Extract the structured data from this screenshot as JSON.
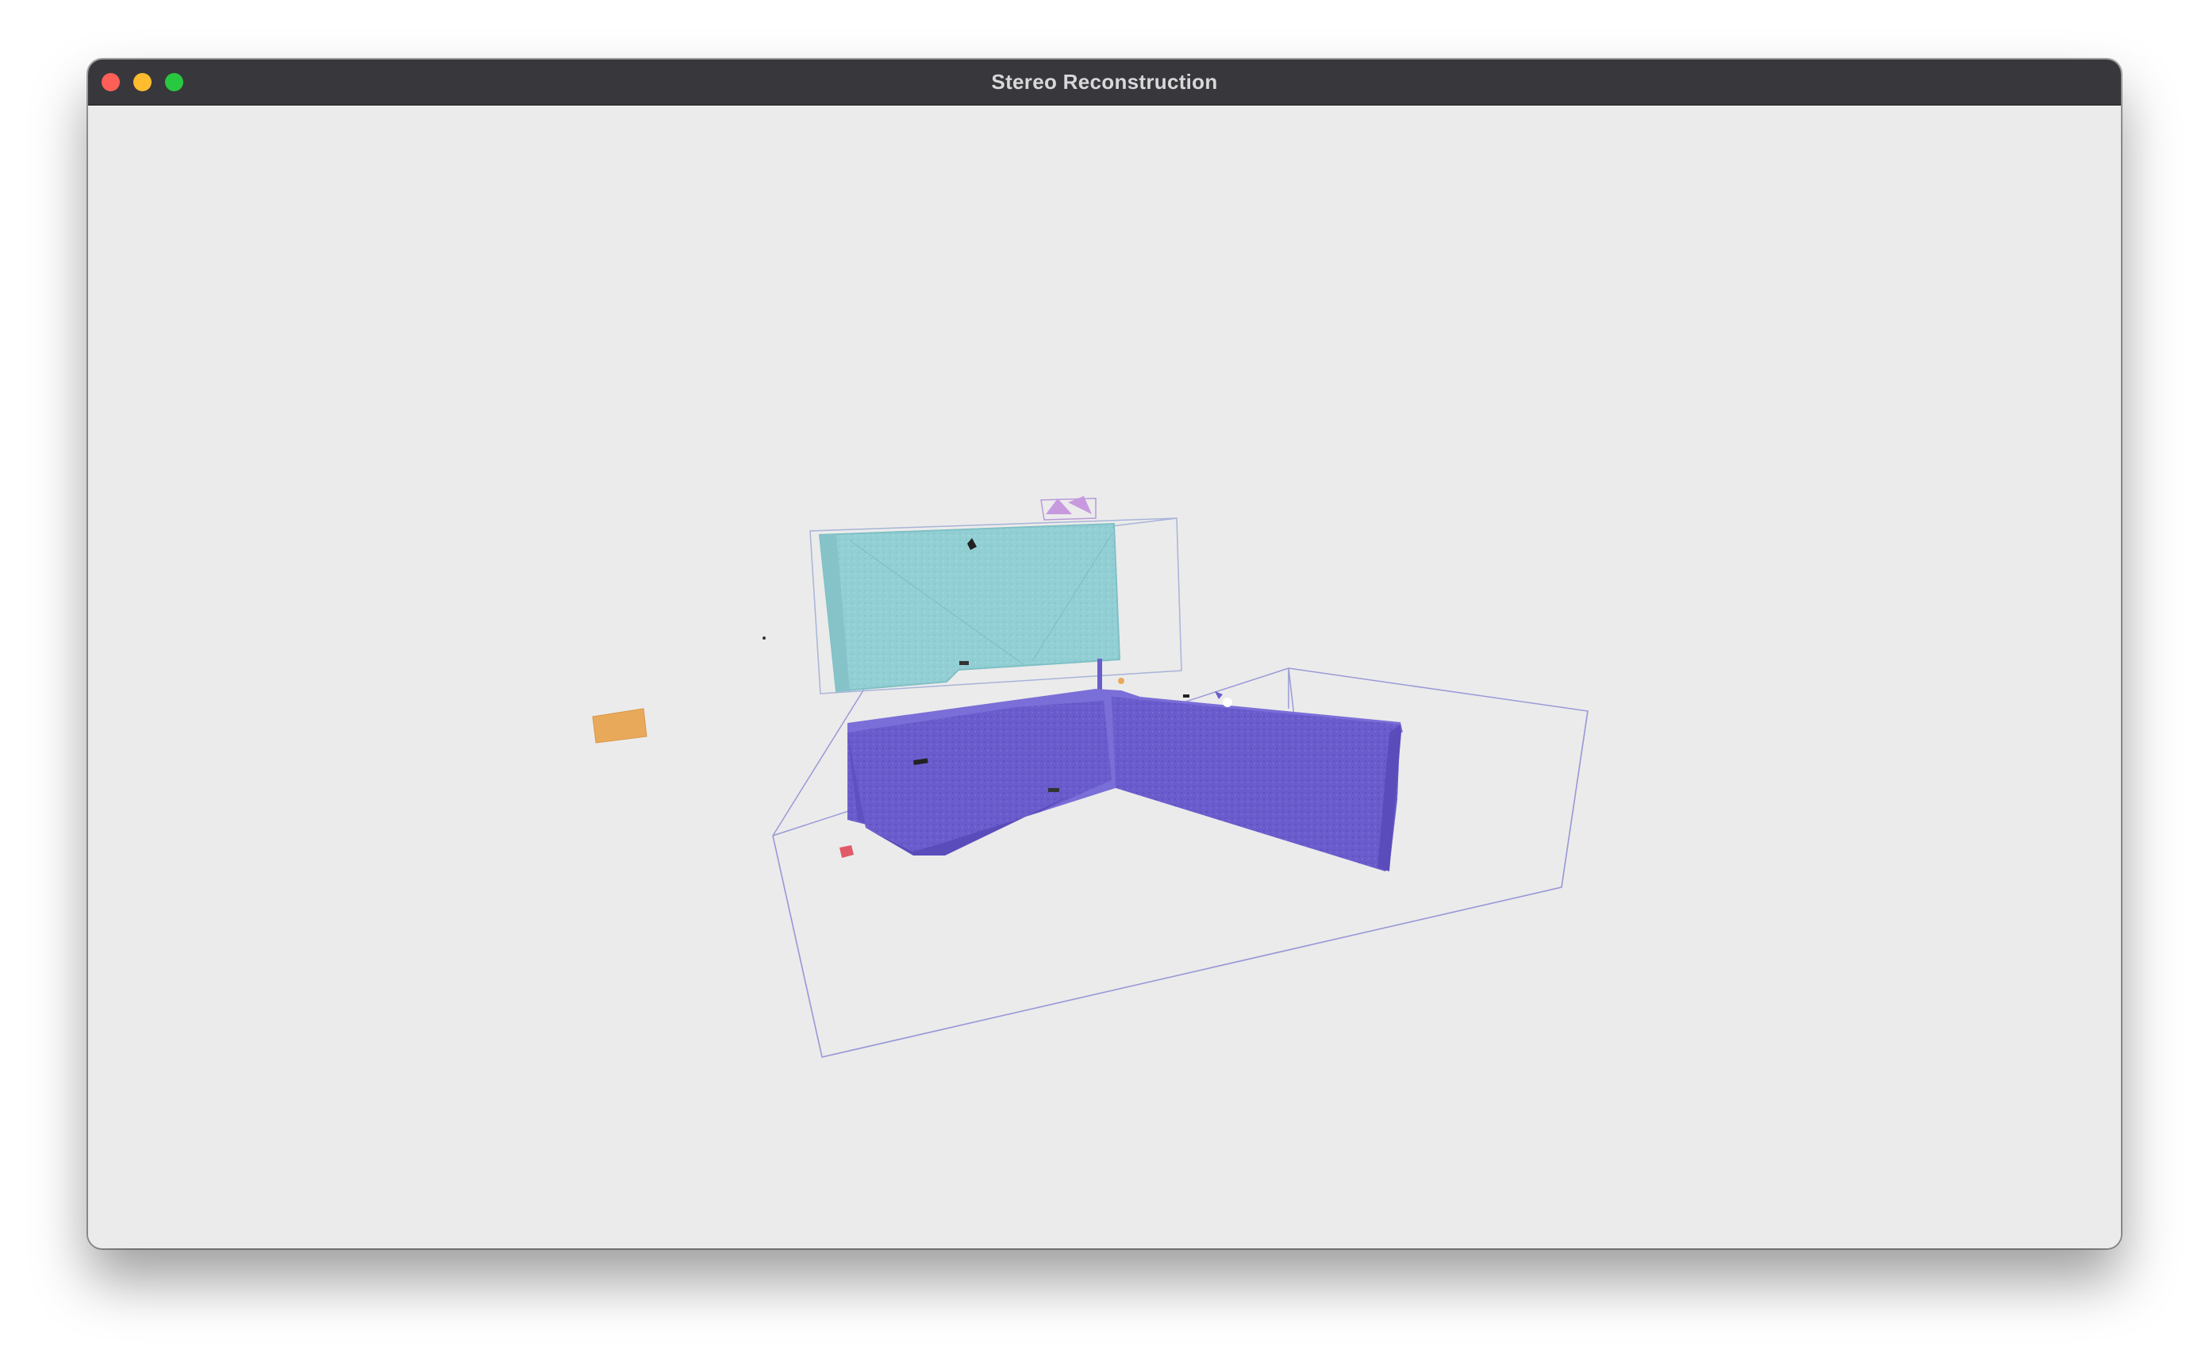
{
  "window": {
    "title": "Stereo Reconstruction"
  },
  "scene": {
    "background_color": "#ebebeb",
    "objects": [
      {
        "name": "counter",
        "color": "#6a5ccc"
      },
      {
        "name": "upper-cabinet",
        "color": "#92cfd4"
      },
      {
        "name": "small-object-purple",
        "color": "#c79ae0"
      },
      {
        "name": "small-object-orange",
        "color": "#e8aa5a"
      },
      {
        "name": "small-object-red",
        "color": "#e05a6a"
      }
    ],
    "bounding_box_color": "#9a9ad8"
  },
  "icons": {
    "close": "close-dot-icon",
    "minimize": "minimize-dot-icon",
    "maximize": "maximize-dot-icon"
  }
}
